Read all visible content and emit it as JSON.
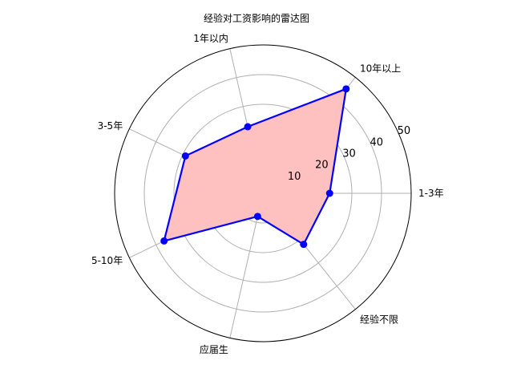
{
  "chart_data": {
    "type": "radar",
    "title": "经验对工资影响的雷达图",
    "categories": [
      "1-3年",
      "10年以上",
      "1年以内",
      "3-5年",
      "5-10年",
      "应届生",
      "经验不限"
    ],
    "values": [
      22.5,
      45,
      23,
      29,
      37,
      8,
      22
    ],
    "radial_ticks": [
      10,
      20,
      30,
      40,
      50
    ],
    "rlim": [
      0,
      50
    ],
    "grid": true,
    "colors": {
      "line": "#0000ff",
      "fill": "#ffc0c0",
      "grid": "#b0b0b0",
      "spine": "#000000"
    }
  }
}
